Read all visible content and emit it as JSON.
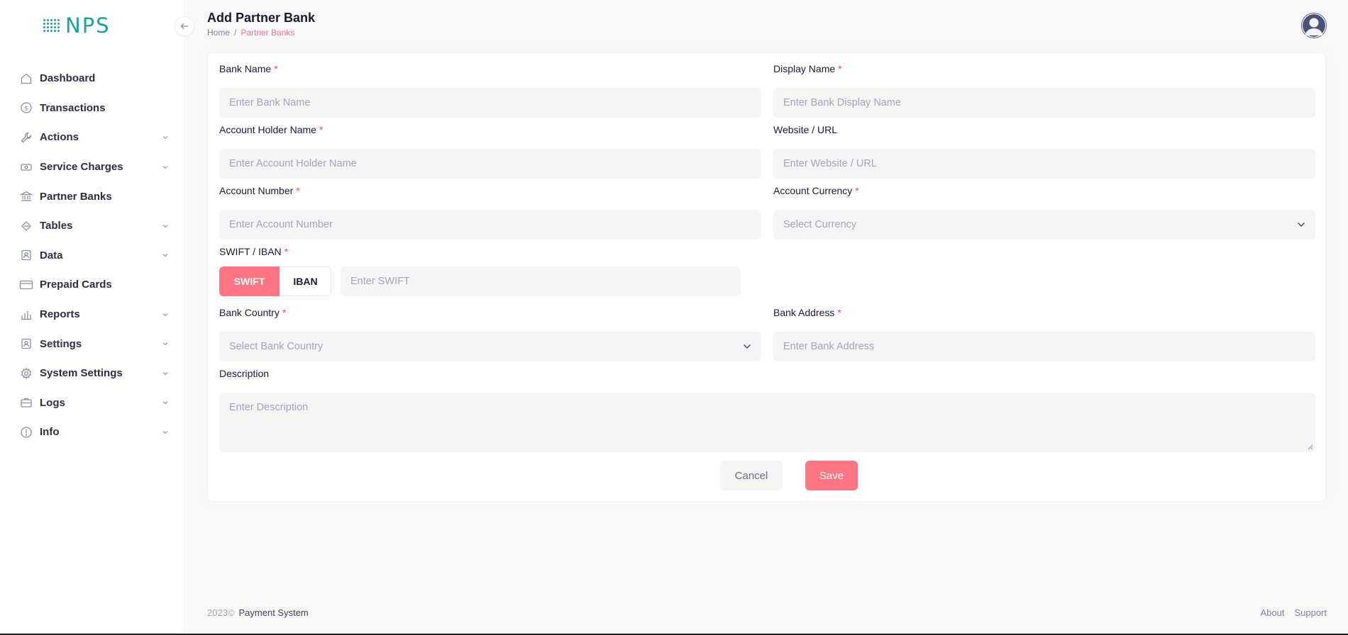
{
  "brand": {
    "logo_text": "NPS"
  },
  "sidebar": {
    "items": [
      {
        "label": "Dashboard",
        "icon": "home-icon",
        "has_submenu": false
      },
      {
        "label": "Transactions",
        "icon": "dollar-circle-icon",
        "has_submenu": false
      },
      {
        "label": "Actions",
        "icon": "wrench-icon",
        "has_submenu": true
      },
      {
        "label": "Service Charges",
        "icon": "cash-icon",
        "has_submenu": true
      },
      {
        "label": "Partner Banks",
        "icon": "bank-icon",
        "has_submenu": false
      },
      {
        "label": "Tables",
        "icon": "arrows-icon",
        "has_submenu": true
      },
      {
        "label": "Data",
        "icon": "contact-card-icon",
        "has_submenu": true
      },
      {
        "label": "Prepaid Cards",
        "icon": "credit-card-icon",
        "has_submenu": false
      },
      {
        "label": "Reports",
        "icon": "bar-chart-icon",
        "has_submenu": true
      },
      {
        "label": "Settings",
        "icon": "contact-card-icon",
        "has_submenu": true
      },
      {
        "label": "System Settings",
        "icon": "gear-icon",
        "has_submenu": true
      },
      {
        "label": "Logs",
        "icon": "briefcase-icon",
        "has_submenu": true
      },
      {
        "label": "Info",
        "icon": "info-icon",
        "has_submenu": true
      }
    ]
  },
  "header": {
    "title": "Add Partner Bank",
    "breadcrumb": {
      "home": "Home",
      "separator": "/",
      "current": "Partner Banks"
    }
  },
  "form": {
    "bank_name": {
      "label": "Bank Name",
      "required_mark": "*",
      "placeholder": "Enter Bank Name"
    },
    "display_name": {
      "label": "Display Name",
      "required_mark": "*",
      "placeholder": "Enter Bank Display Name"
    },
    "account_holder": {
      "label": "Account Holder Name",
      "required_mark": "*",
      "placeholder": "Enter Account Holder Name"
    },
    "website": {
      "label": "Website / URL",
      "placeholder": "Enter Website / URL"
    },
    "account_number": {
      "label": "Account Number",
      "required_mark": "*",
      "placeholder": "Enter Account Number"
    },
    "account_currency": {
      "label": "Account Currency",
      "required_mark": "*",
      "placeholder": "Select Currency"
    },
    "swift_iban": {
      "label": "SWIFT / IBAN",
      "required_mark": "*",
      "option_swift": "SWIFT",
      "option_iban": "IBAN",
      "selected": "SWIFT",
      "placeholder": "Enter SWIFT"
    },
    "bank_country": {
      "label": "Bank Country",
      "required_mark": "*",
      "placeholder": "Select Bank Country"
    },
    "bank_address": {
      "label": "Bank Address",
      "required_mark": "*",
      "placeholder": "Enter Bank Address"
    },
    "description": {
      "label": "Description",
      "placeholder": "Enter Description"
    },
    "cancel_label": "Cancel",
    "save_label": "Save"
  },
  "footer": {
    "year": "2023©",
    "company": "Payment System",
    "about": "About",
    "support": "Support"
  },
  "colors": {
    "accent": "#ff7583",
    "brand": "#1ba39c",
    "required": "#f1416c",
    "input_bg": "#f5f5f8"
  }
}
